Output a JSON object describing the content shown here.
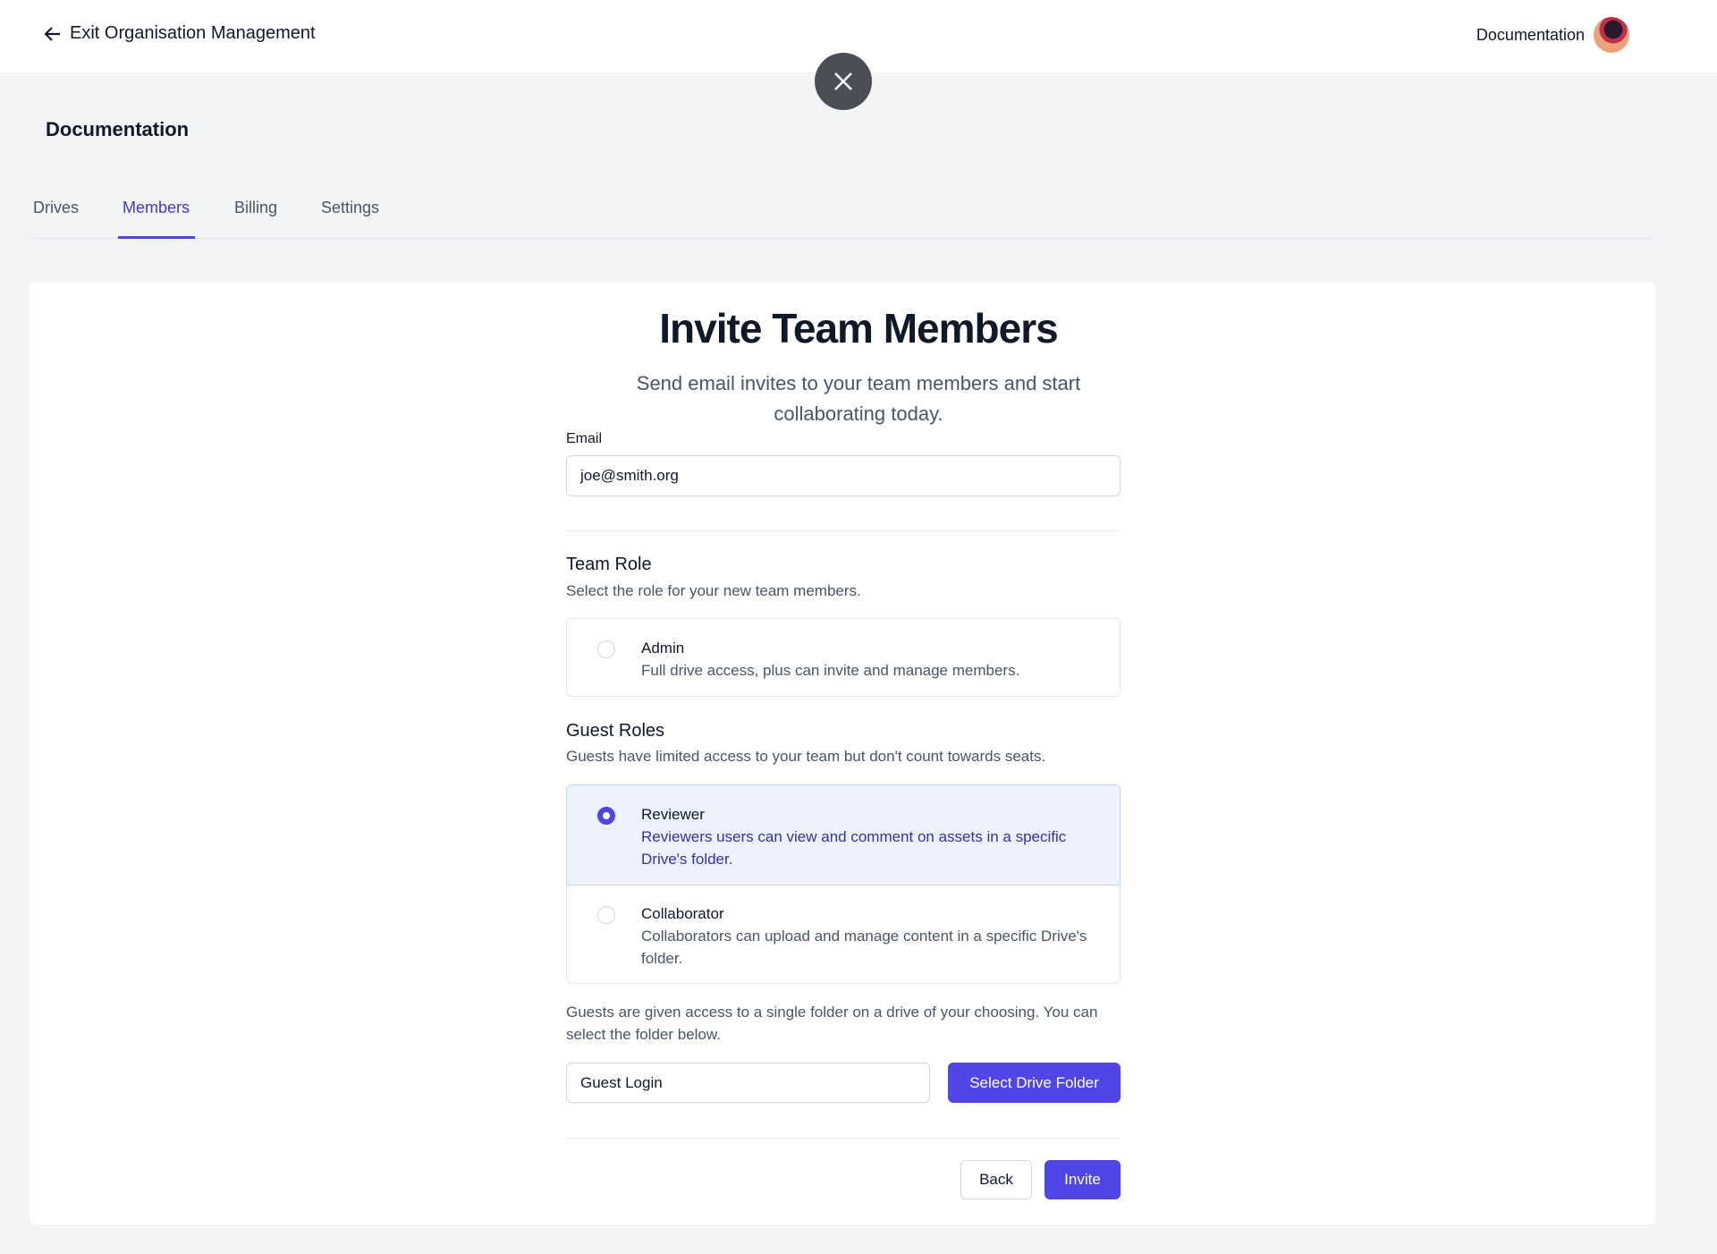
{
  "header": {
    "exit_label": "Exit Organisation Management",
    "org_name": "Documentation"
  },
  "org": {
    "title": "Documentation"
  },
  "tabs": [
    {
      "label": "Drives"
    },
    {
      "label": "Members",
      "active": true
    },
    {
      "label": "Billing"
    },
    {
      "label": "Settings"
    }
  ],
  "invite": {
    "title": "Invite Team Members",
    "subtitle": "Send email invites to your team members and start collaborating today.",
    "email_label": "Email",
    "email_value": "joe@smith.org",
    "team_role_title": "Team Role",
    "team_role_desc": "Select the role for your new team members.",
    "team_roles": [
      {
        "name": "Admin",
        "desc": "Full drive access, plus can invite and manage members.",
        "selected": false
      }
    ],
    "guest_roles_title": "Guest Roles",
    "guest_roles_desc": "Guests have limited access to your team but don't count towards seats.",
    "guest_roles": [
      {
        "name": "Reviewer",
        "desc": "Reviewers users can view and comment on assets in a specific Drive's folder.",
        "selected": true
      },
      {
        "name": "Collaborator",
        "desc": "Collaborators can upload and manage content in a specific Drive's folder.",
        "selected": false
      }
    ],
    "guest_note": "Guests are given access to a single folder on a drive of your choosing. You can select the folder below.",
    "folder_value": "Guest Login",
    "select_folder_label": "Select Drive Folder",
    "back_label": "Back",
    "invite_label": "Invite"
  },
  "colors": {
    "accent": "#4f46e5",
    "selected_bg": "#eef2ff",
    "selected_text": "#3730a3"
  }
}
